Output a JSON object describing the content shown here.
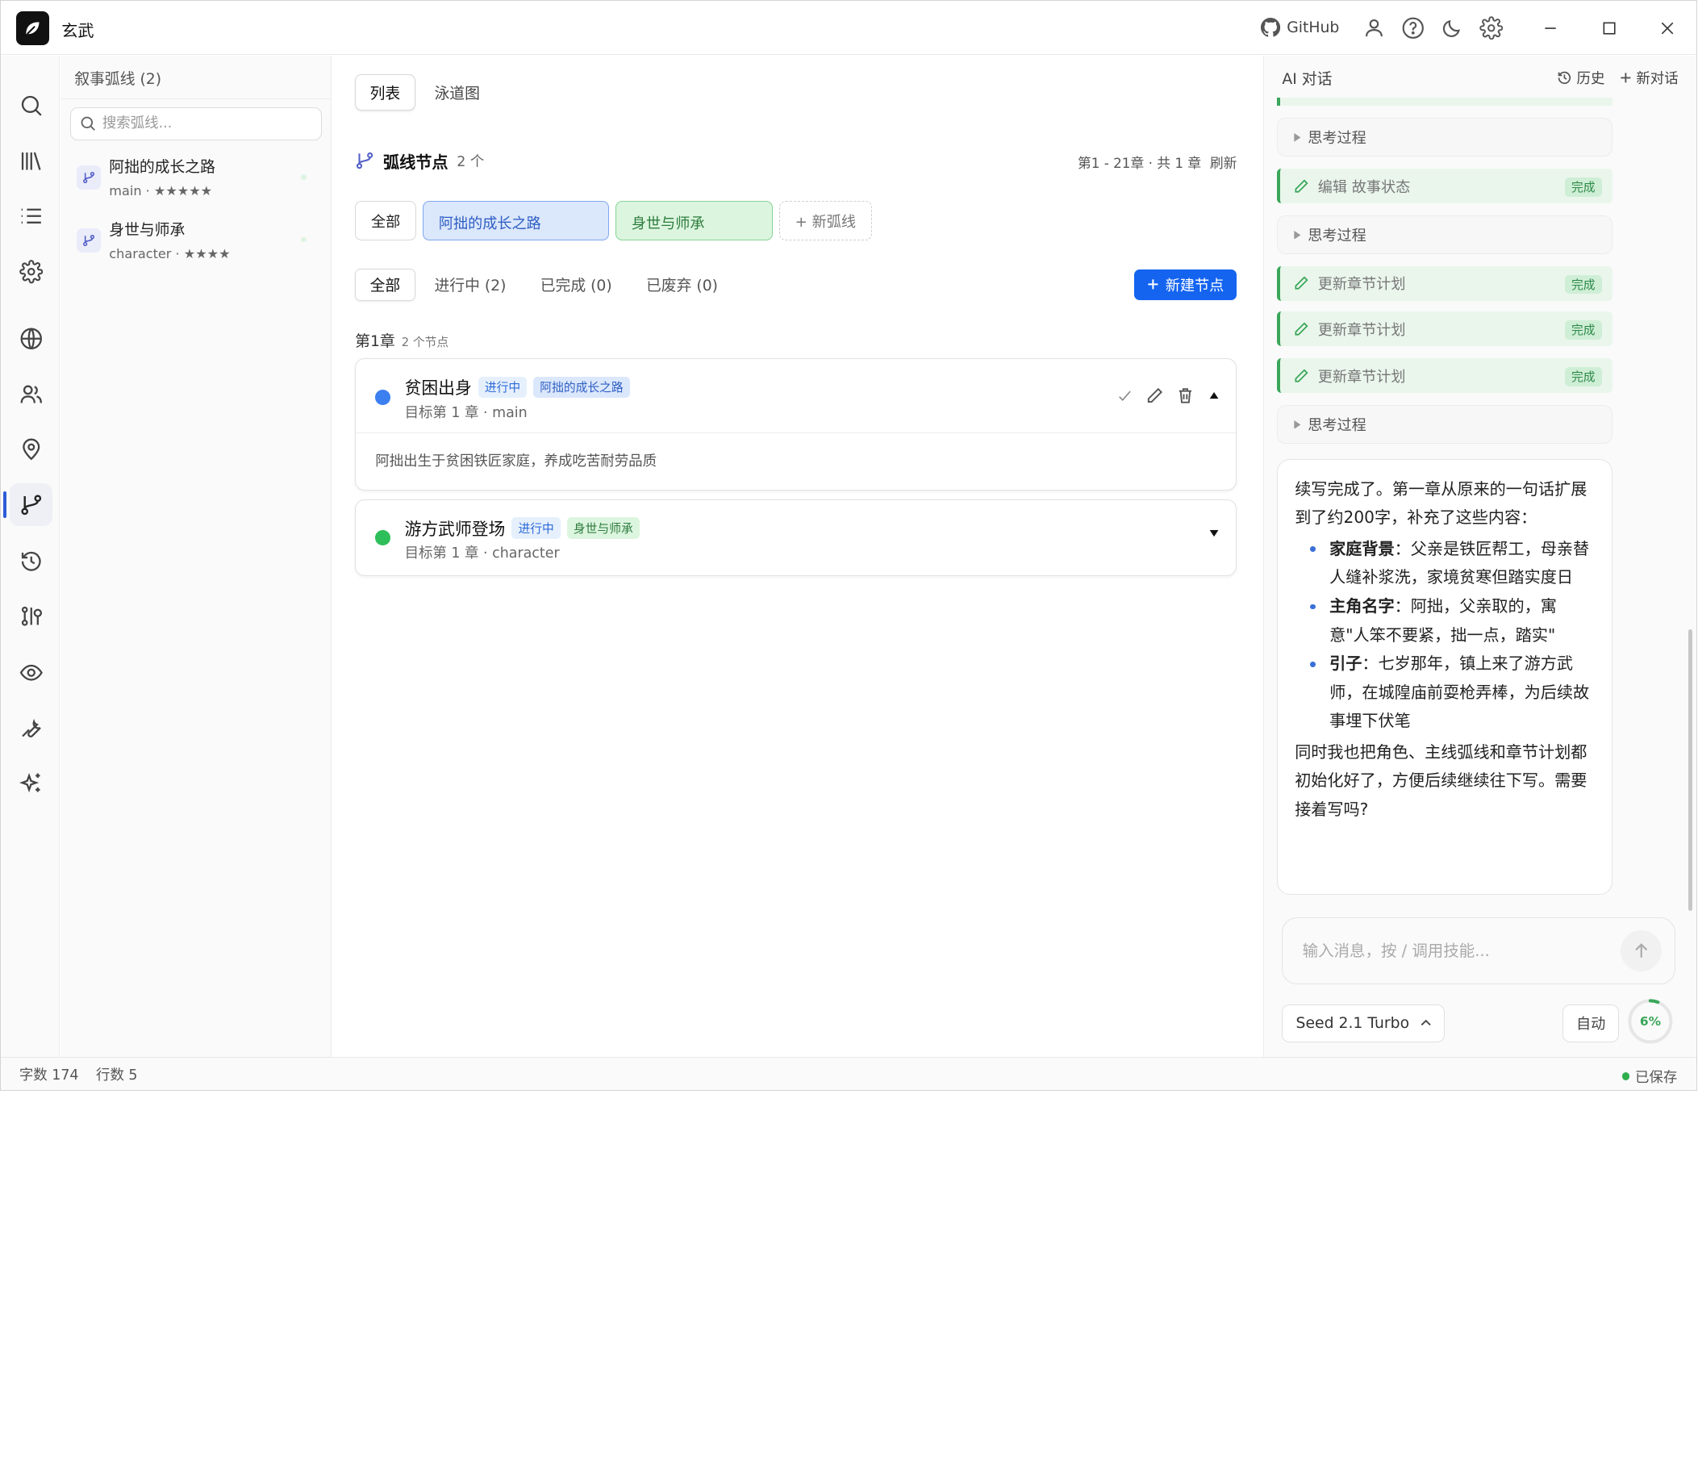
{
  "app": {
    "title": "玄武"
  },
  "titlebar": {
    "github_label": "GitHub"
  },
  "sidebar": {
    "header": "叙事弧线 (2)",
    "search_placeholder": "搜索弧线...",
    "arcs": [
      {
        "name": "阿拙的成长之路",
        "meta": "main · ★★★★★"
      },
      {
        "name": "身世与师承",
        "meta": "character · ★★★★"
      }
    ]
  },
  "main": {
    "view_tabs": [
      "列表",
      "泳道图"
    ],
    "section_title": "弧线节点",
    "section_count": "2 个",
    "range_text": "第1 - 21章 · 共 1 章",
    "refresh_label": "刷新",
    "arc_filters": {
      "all": "全部",
      "arc1": "阿拙的成长之路",
      "arc2": "身世与师承",
      "new": "+ 新弧线"
    },
    "status_filters": [
      "全部",
      "进行中 (2)",
      "已完成 (0)",
      "已废弃 (0)"
    ],
    "new_node_label": "新建节点",
    "chapter": {
      "name": "第1章",
      "count": "2 个节点"
    },
    "nodes": [
      {
        "title": "贫困出身",
        "status": "进行中",
        "arc": "阿拙的成长之路",
        "meta": "目标第 1 章 · main",
        "description": "阿拙出生于贫困铁匠家庭，养成吃苦耐劳品质",
        "dot_color": "#3b7ff0"
      },
      {
        "title": "游方武师登场",
        "status": "进行中",
        "arc": "身世与师承",
        "meta": "目标第 1 章 · character",
        "dot_color": "#2fbf5a"
      }
    ]
  },
  "ai_panel": {
    "title": "AI 对话",
    "history_label": "历史",
    "new_chat_label": "新对话",
    "think_label": "思考过程",
    "tool_edit_state": "编辑 故事状态",
    "tool_update_plan": "更新章节计划",
    "done_label": "完成",
    "answer": {
      "intro": "续写完成了。第一章从原来的一句话扩展到了约200字，补充了这些内容：",
      "points": [
        {
          "title": "家庭背景",
          "text": "：父亲是铁匠帮工，母亲替人缝补浆洗，家境贫寒但踏实度日"
        },
        {
          "title": "主角名字",
          "text": "：阿拙，父亲取的，寓意\"人笨不要紧，拙一点，踏实\""
        },
        {
          "title": "引子",
          "text": "：七岁那年，镇上来了游方武师，在城隍庙前耍枪弄棒，为后续故事埋下伏笔"
        }
      ],
      "outro": "同时我也把角色、主线弧线和章节计划都初始化好了，方便后续继续往下写。需要接着写吗?"
    },
    "composer_placeholder": "输入消息，按 / 调用技能...",
    "model_label": "Seed 2.1 Turbo",
    "auto_label": "自动",
    "context_usage": "6%",
    "context_fraction": 0.06
  },
  "statusbar": {
    "word_count": "字数 174",
    "line_count": "行数 5",
    "saved_label": "已保存"
  }
}
